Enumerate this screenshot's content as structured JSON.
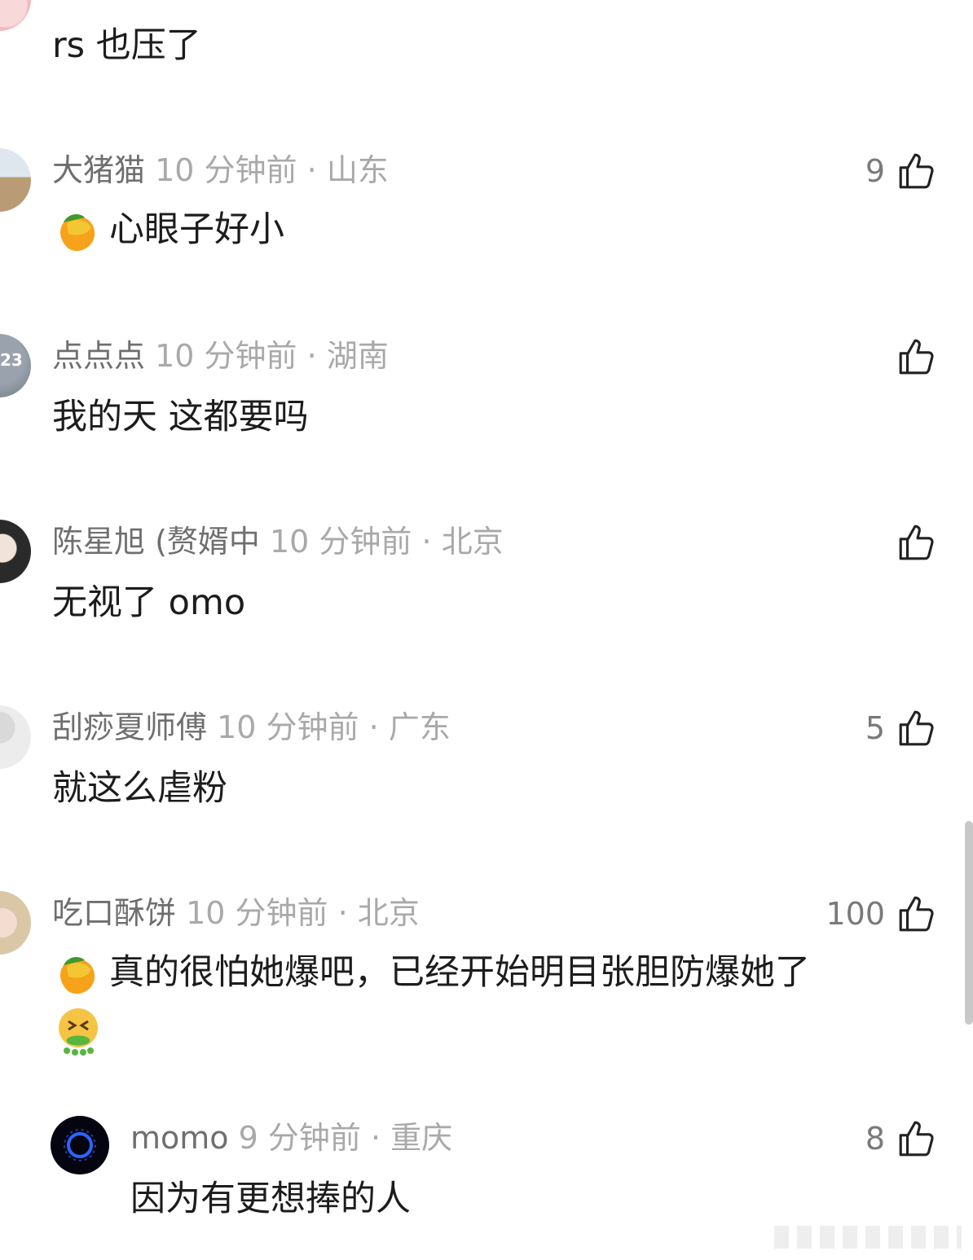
{
  "comments": [
    {
      "username": "",
      "time": "",
      "location": "",
      "likes": "",
      "text": "rs 也压了"
    },
    {
      "username": "大猪猫",
      "time": "10 分钟前",
      "location": "山东",
      "likes": "9",
      "text": "心眼子好小",
      "emoji": "mango-emoji"
    },
    {
      "username": "点点点",
      "time": "10 分钟前",
      "location": "湖南",
      "likes": "",
      "text": "我的天 这都要吗",
      "avatar_text": "23"
    },
    {
      "username": "陈星旭 (赘婿中",
      "time": "10 分钟前",
      "location": "北京",
      "likes": "",
      "text": "无视了 omo"
    },
    {
      "username": "刮痧夏师傅",
      "time": "10 分钟前",
      "location": "广东",
      "likes": "5",
      "text": "就这么虐粉"
    },
    {
      "username": "吃口酥饼",
      "time": "10 分钟前",
      "location": "北京",
      "likes": "100",
      "text": "真的很怕她爆吧，已经开始明目张胆防爆她了",
      "emoji": "mango-emoji",
      "trailing_emoji": "vomiting-face-emoji"
    }
  ],
  "reply": {
    "username": "momo",
    "time": "9 分钟前",
    "location": "重庆",
    "likes": "8",
    "text": "因为有更想捧的人"
  },
  "separator": "·",
  "icons": {
    "like": "thumbs-up-icon"
  },
  "colors": {
    "username": "#6f6f6f",
    "meta": "#a9a9a9",
    "text": "#1c1c1c",
    "background": "#ffffff"
  }
}
